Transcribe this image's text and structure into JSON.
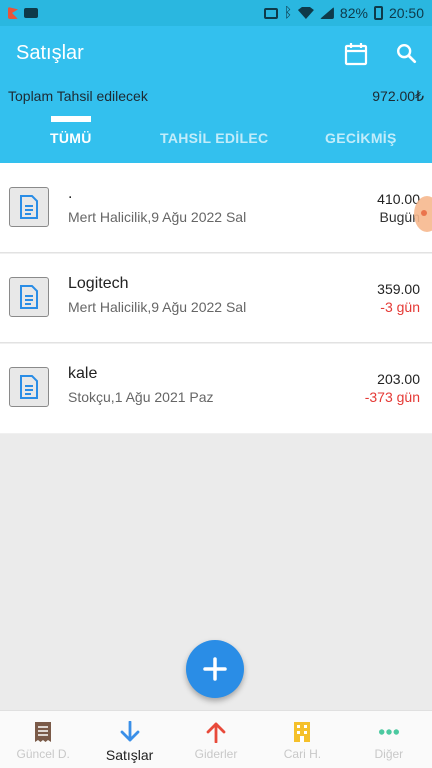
{
  "status_bar": {
    "battery": "82%",
    "time": "20:50"
  },
  "app_bar": {
    "title": "Satışlar"
  },
  "summary": {
    "label": "Toplam Tahsil edilecek",
    "value": "972.00₺"
  },
  "tabs": [
    {
      "label": "TÜMÜ",
      "active": true
    },
    {
      "label": "TAHSİL EDİLECE",
      "active": false
    },
    {
      "label": "GECİKMİŞ",
      "active": false
    }
  ],
  "rows": [
    {
      "title": ".",
      "subtitle": "Mert Halicilik,9 Ağu 2022 Sal",
      "amount": "410.00",
      "days": "Bugün",
      "late": false
    },
    {
      "title": "Logitech",
      "subtitle": "Mert Halicilik,9 Ağu 2022 Sal",
      "amount": "359.00",
      "days": "-3 gün",
      "late": true
    },
    {
      "title": "kale",
      "subtitle": "Stokçu,1 Ağu 2021 Paz",
      "amount": "203.00",
      "days": "-373 gün",
      "late": true
    }
  ],
  "bottom_nav": [
    {
      "label": "Güncel D.",
      "icon": "receipt-icon",
      "color": "#7a5a48",
      "active": false
    },
    {
      "label": "Satışlar",
      "icon": "arrow-down-icon",
      "color": "#3a8fe8",
      "active": true
    },
    {
      "label": "Giderler",
      "icon": "arrow-up-icon",
      "color": "#e84a3a",
      "active": false
    },
    {
      "label": "Cari H.",
      "icon": "building-icon",
      "color": "#f5c02a",
      "active": false
    },
    {
      "label": "Diğer",
      "icon": "more-dots-icon",
      "color": "#4cc9a0",
      "active": false
    }
  ],
  "colors": {
    "primary": "#33c0ee",
    "status_bar": "#2ab7e0",
    "fab": "#2a8de6",
    "late": "#e53935"
  }
}
